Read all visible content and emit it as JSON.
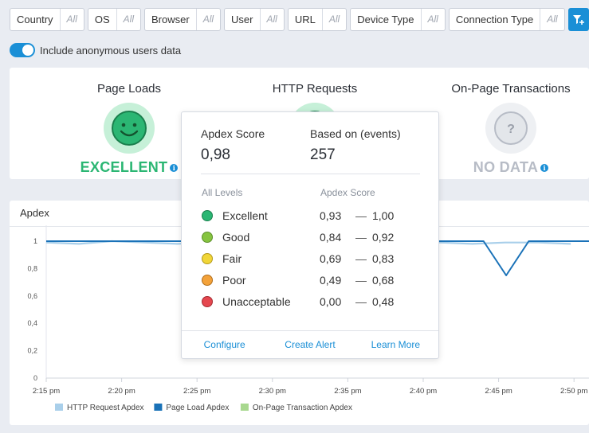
{
  "filters": [
    {
      "label": "Country",
      "value": "All"
    },
    {
      "label": "OS",
      "value": "All"
    },
    {
      "label": "Browser",
      "value": "All"
    },
    {
      "label": "User",
      "value": "All"
    },
    {
      "label": "URL",
      "value": "All"
    },
    {
      "label": "Device Type",
      "value": "All"
    },
    {
      "label": "Connection Type",
      "value": "All"
    }
  ],
  "anon_toggle": {
    "label": "Include anonymous users data",
    "on": true
  },
  "summary": {
    "page_loads": {
      "title": "Page Loads",
      "status": "EXCELLENT",
      "color": "#2bb673"
    },
    "http_requests": {
      "title": "HTTP Requests"
    },
    "on_page": {
      "title": "On-Page Transactions",
      "status": "NO DATA",
      "face": "?",
      "color": "#b7bcc6"
    }
  },
  "chart": {
    "title": "Apdex"
  },
  "tooltip": {
    "score_label": "Apdex Score",
    "score_value": "0,98",
    "events_label": "Based on (events)",
    "events_value": "257",
    "levels_header": "All Levels",
    "scores_header": "Apdex Score",
    "levels": [
      {
        "name": "Excellent",
        "from": "0,93",
        "to": "1,00",
        "color": "#2bb673"
      },
      {
        "name": "Good",
        "from": "0,84",
        "to": "0,92",
        "color": "#86c440"
      },
      {
        "name": "Fair",
        "from": "0,69",
        "to": "0,83",
        "color": "#f1d638"
      },
      {
        "name": "Poor",
        "from": "0,49",
        "to": "0,68",
        "color": "#f3a23a"
      },
      {
        "name": "Unacceptable",
        "from": "0,00",
        "to": "0,48",
        "color": "#e5474f"
      }
    ],
    "dash": "—",
    "actions": [
      "Configure",
      "Create Alert",
      "Learn More"
    ]
  },
  "chart_data": {
    "type": "line",
    "title": "Apdex",
    "x": [
      "2:15 pm",
      "2:20 pm",
      "2:25 pm",
      "2:30 pm",
      "2:35 pm",
      "2:40 pm",
      "2:45 pm",
      "2:50 pm"
    ],
    "y_ticks": [
      "0",
      "0,2",
      "0,4",
      "0,6",
      "0,8",
      "1"
    ],
    "ylim": [
      0,
      1
    ],
    "series": [
      {
        "name": "HTTP Request Apdex",
        "color": "#a9cfea",
        "points": [
          [
            0,
            0.99
          ],
          [
            1,
            0.98
          ],
          [
            2,
            1.0
          ],
          [
            3,
            0.99
          ],
          [
            4,
            0.98
          ],
          [
            5,
            0.99
          ],
          [
            6,
            1.0
          ],
          [
            7,
            0.99
          ],
          [
            8,
            0.98
          ],
          [
            9,
            0.99
          ],
          [
            10,
            0.98
          ],
          [
            11,
            1.0
          ],
          [
            12,
            0.99
          ],
          [
            13,
            0.98
          ],
          [
            14,
            0.99
          ],
          [
            15,
            0.99
          ],
          [
            16,
            0.98
          ]
        ]
      },
      {
        "name": "Page Load Apdex",
        "color": "#1a72b8",
        "points": [
          [
            0,
            1.0
          ],
          [
            0.5,
            1.0
          ],
          [
            1,
            1.0
          ],
          [
            1.5,
            1.0
          ],
          [
            2,
            1.0
          ],
          [
            2.5,
            1.0
          ],
          [
            3,
            1.0
          ],
          [
            3.5,
            1.0
          ],
          [
            4,
            1.0
          ],
          [
            4.5,
            1.0
          ],
          [
            5,
            1.0
          ],
          [
            5.5,
            1.0
          ],
          [
            5.8,
            1.0
          ],
          [
            6.1,
            0.75
          ],
          [
            6.4,
            1.0
          ],
          [
            7,
            1.0
          ],
          [
            7.5,
            1.0
          ]
        ]
      },
      {
        "name": "On-Page Transaction Apdex",
        "color": "#a8d88f",
        "points": []
      }
    ]
  }
}
